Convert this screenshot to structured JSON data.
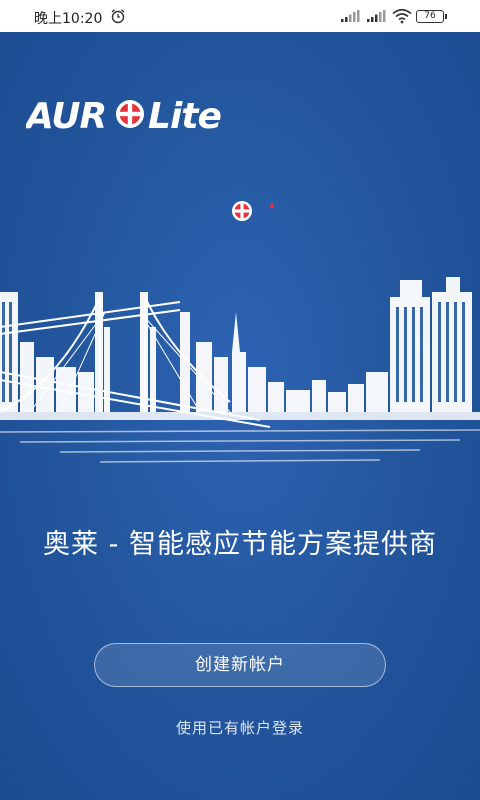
{
  "status_bar": {
    "time": "晚上10:20",
    "battery": "76"
  },
  "brand": {
    "logo_text_left": "AUR",
    "logo_text_right": "Lite",
    "accent_color": "#e8313a",
    "background_color": "#24589f"
  },
  "tagline": "奥莱 - 智能感应节能方案提供商",
  "actions": {
    "create_account": "创建新帐户",
    "login_existing": "使用已有帐户登录"
  },
  "icons": {
    "alarm": "alarm-clock-icon",
    "signal": "cellular-signal-icon",
    "wifi": "wifi-icon",
    "battery": "battery-icon",
    "logo_mark": "logo-circle-mark"
  }
}
